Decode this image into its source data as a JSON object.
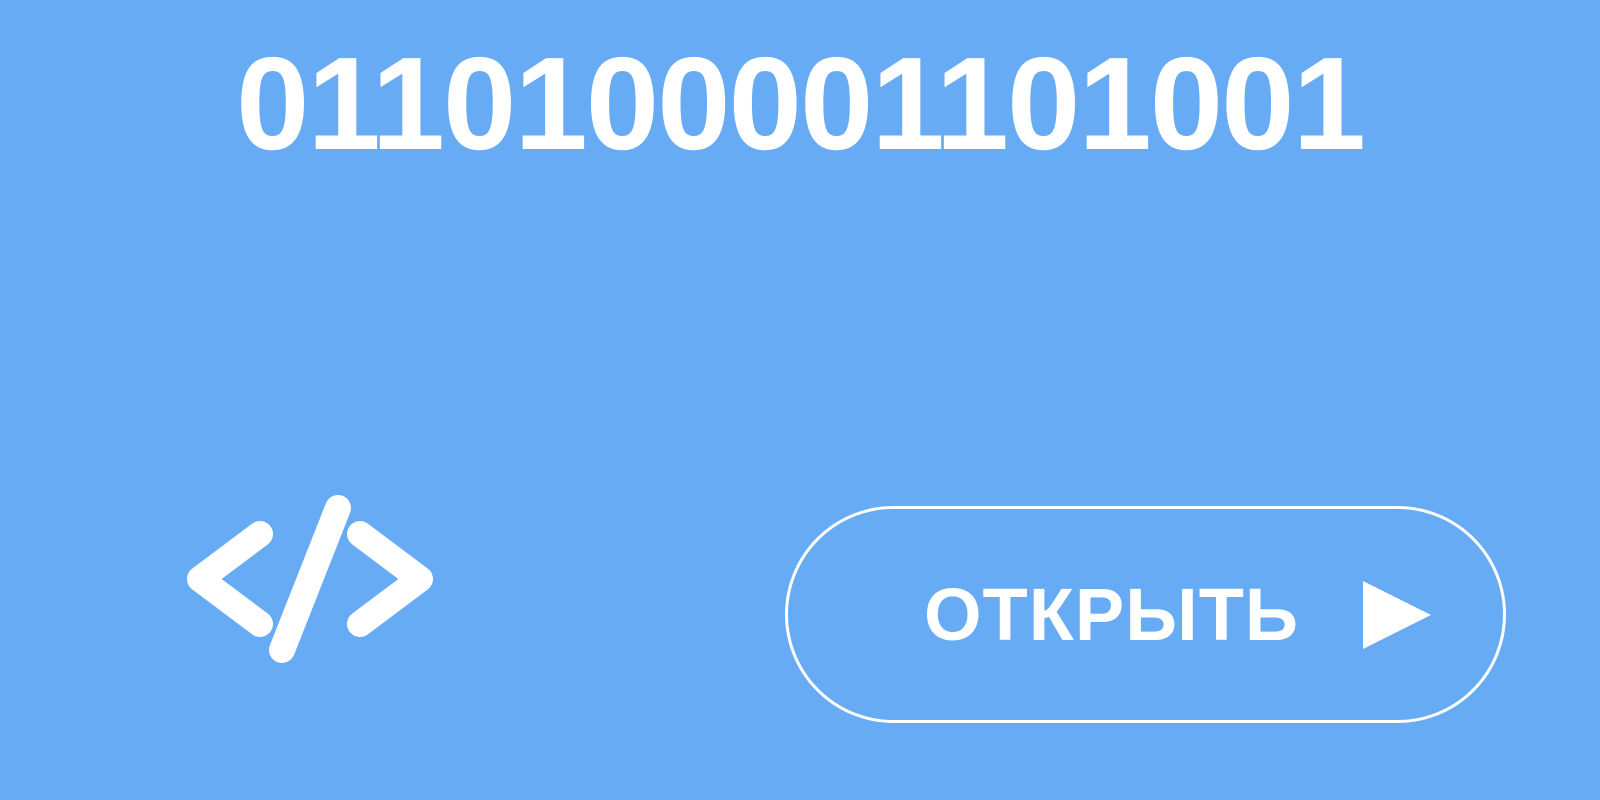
{
  "app": {
    "binary_text": "0110100001101001",
    "icon": "code-icon",
    "button": {
      "label": "ОТКРЫТЬ",
      "icon": "play-icon"
    },
    "colors": {
      "background": "#66abf3",
      "foreground": "#ffffff"
    }
  }
}
